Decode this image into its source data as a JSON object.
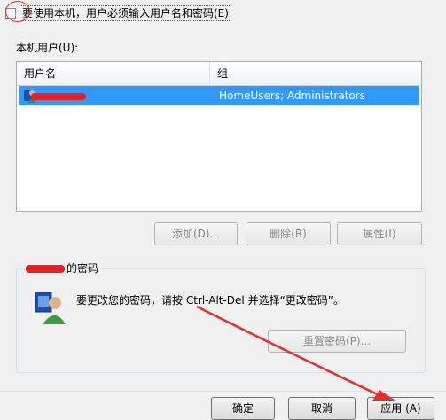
{
  "require_login_checkbox": {
    "label": "要使用本机，用户必须输入用户名和密码(E)",
    "checked": false
  },
  "users_label": "本机用户(U):",
  "users_list": {
    "columns": [
      "用户名",
      "组"
    ],
    "rows": [
      {
        "user": "",
        "group": "HomeUsers; Administrators",
        "selected": true
      }
    ]
  },
  "list_buttons": {
    "add": "添加(D)...",
    "remove": "删除(R)",
    "properties": "属性(I)"
  },
  "password_group": {
    "title_suffix": "的密码",
    "message": "要更改您的密码，请按 Ctrl-Alt-Del 并选择“更改密码”。",
    "reset_button": "重置密码(P)..."
  },
  "dialog_buttons": {
    "ok": "确定",
    "cancel": "取消",
    "apply": "应用 (A)"
  },
  "colors": {
    "selection": "#3399ff",
    "annotation_red": "#e03030"
  }
}
